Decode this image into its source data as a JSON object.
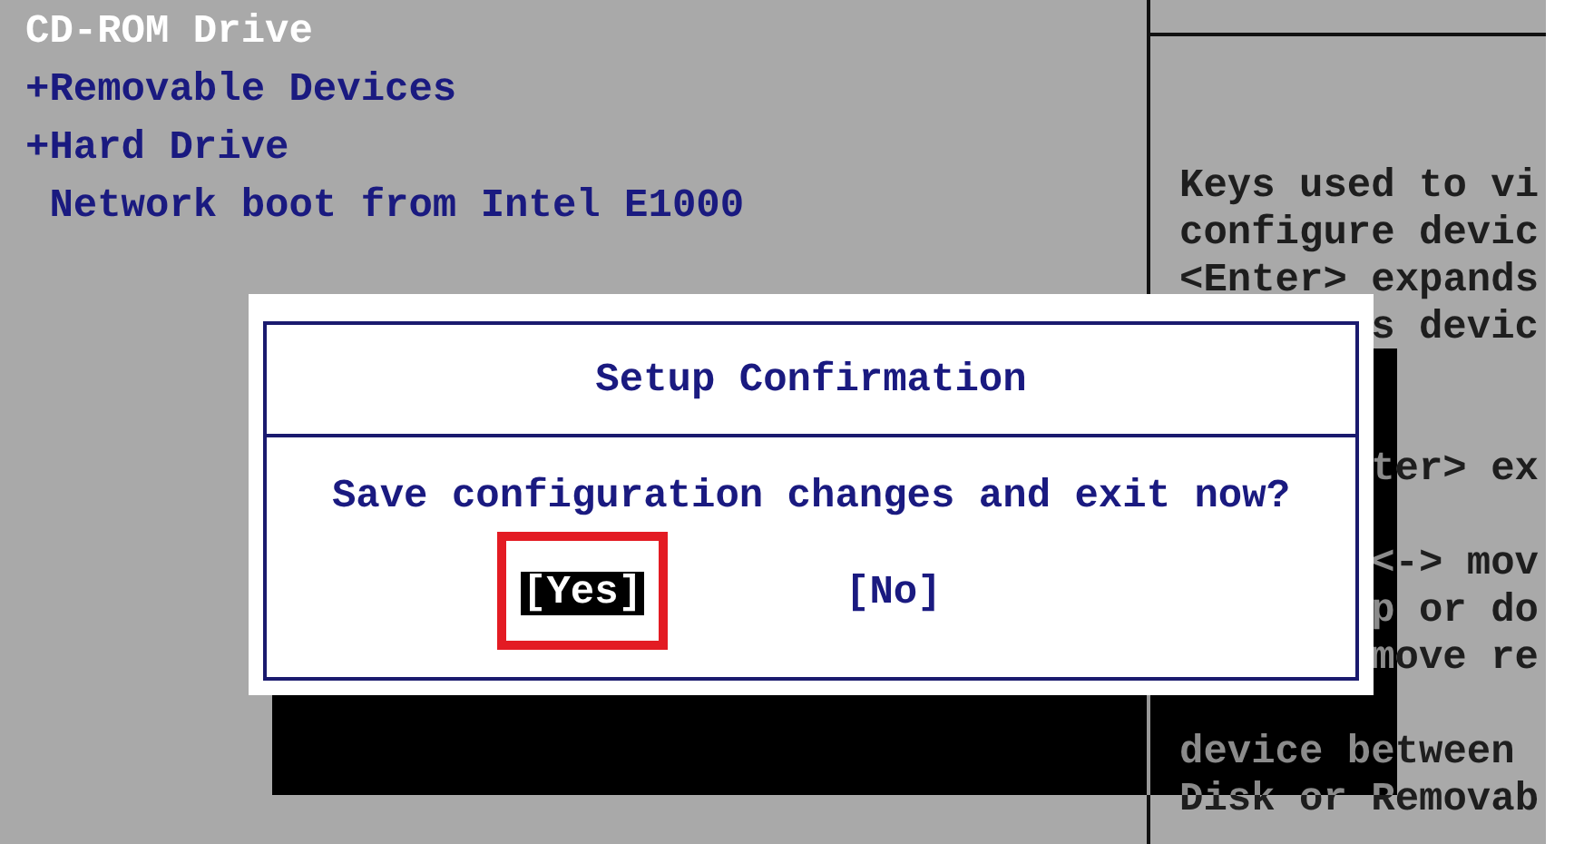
{
  "boot_order": [
    {
      "label": "CD-ROM Drive",
      "selected": true
    },
    {
      "label": "+Removable Devices",
      "selected": false
    },
    {
      "label": "+Hard Drive",
      "selected": false
    },
    {
      "label": " Network boot from Intel E1000",
      "selected": false
    }
  ],
  "help_panel": {
    "lines": [
      "Keys used to vi",
      "configure devic",
      "<Enter> expands",
      "s devic",
      "ter> ex",
      "<-> mov",
      "p or do",
      "move re",
      "device between",
      "Disk or Removab"
    ]
  },
  "dialog": {
    "title": "Setup Confirmation",
    "message": "Save configuration changes and exit now?",
    "buttons": [
      {
        "label": "[Yes]",
        "selected": true,
        "outlined": true
      },
      {
        "label": "[No]",
        "selected": false,
        "outlined": false
      }
    ]
  }
}
